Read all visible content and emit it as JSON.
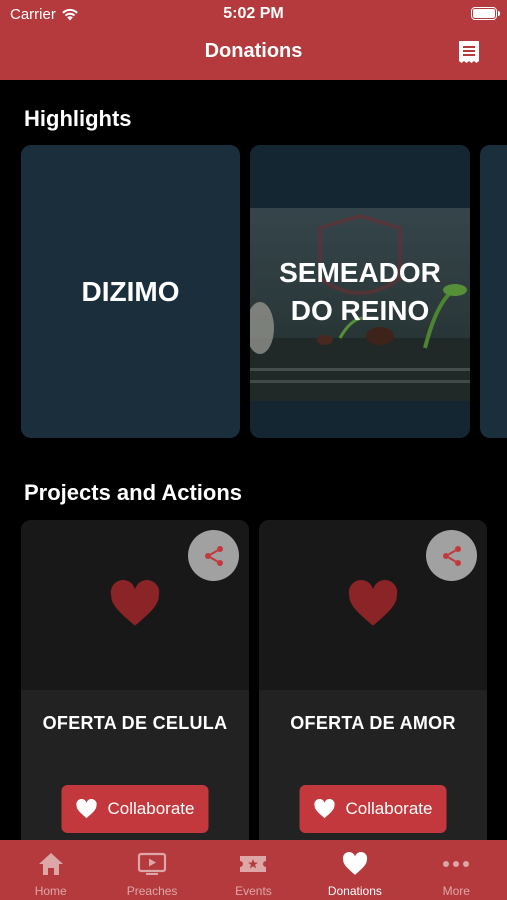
{
  "status": {
    "carrier": "Carrier",
    "time": "5:02 PM"
  },
  "nav": {
    "title": "Donations"
  },
  "highlights": {
    "title": "Highlights",
    "cards": [
      {
        "label": "DIZIMO"
      },
      {
        "label": "SEMEADOR DO REINO"
      },
      {
        "label": ""
      }
    ]
  },
  "projects": {
    "title": "Projects and Actions",
    "cards": [
      {
        "name": "OFERTA DE CELULA",
        "button": "Collaborate"
      },
      {
        "name": "OFERTA DE AMOR",
        "button": "Collaborate"
      }
    ]
  },
  "tabs": [
    {
      "label": "Home",
      "icon": "home-icon",
      "active": false
    },
    {
      "label": "Preaches",
      "icon": "video-icon",
      "active": false
    },
    {
      "label": "Events",
      "icon": "ticket-icon",
      "active": false
    },
    {
      "label": "Donations",
      "icon": "heart-icon",
      "active": true
    },
    {
      "label": "More",
      "icon": "more-icon",
      "active": false
    }
  ],
  "colors": {
    "brand": "#b43a3d",
    "button": "#c2383c",
    "heart": "#8b2427",
    "card": "#1a2e3c"
  }
}
